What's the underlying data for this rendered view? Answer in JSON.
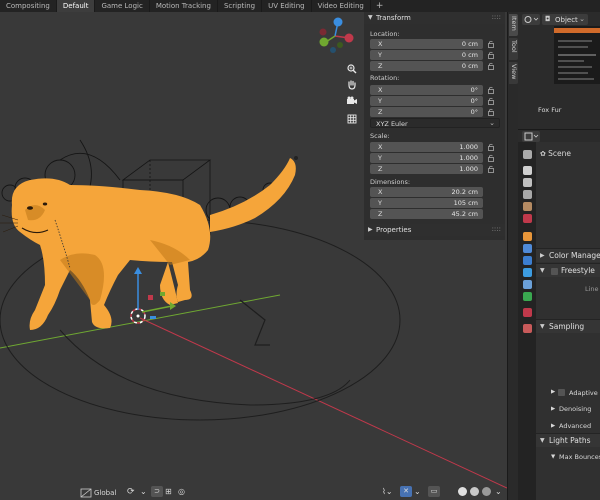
{
  "workspace_tabs": [
    "Compositing",
    "Default",
    "Game Logic",
    "Motion Tracking",
    "Scripting",
    "UV Editing",
    "Video Editing"
  ],
  "active_tab_index": 1,
  "add_tab_label": "+",
  "viewport": {
    "nav_icons": [
      "zoom-icon",
      "hand-pan-icon",
      "camera-icon",
      "grid-icon"
    ],
    "gizmo_axes": [
      "X",
      "Y",
      "Z"
    ],
    "bottom_bar": {
      "orientation_label": "Global",
      "header_right_icons": [
        "overlay-icon",
        "xray-icon",
        "wireframe-shading-icon",
        "solid-shading-icon",
        "material-shading-icon",
        "rendered-shading-icon"
      ]
    }
  },
  "npanel": {
    "transform_title": "Transform",
    "location": {
      "label": "Location:",
      "fields": [
        {
          "axis": "X",
          "value": "0 cm"
        },
        {
          "axis": "Y",
          "value": "0 cm"
        },
        {
          "axis": "Z",
          "value": "0 cm"
        }
      ]
    },
    "rotation": {
      "label": "Rotation:",
      "fields": [
        {
          "axis": "X",
          "value": "0°"
        },
        {
          "axis": "Y",
          "value": "0°"
        },
        {
          "axis": "Z",
          "value": "0°"
        }
      ],
      "mode": "XYZ Euler"
    },
    "scale": {
      "label": "Scale:",
      "fields": [
        {
          "axis": "X",
          "value": "1.000"
        },
        {
          "axis": "Y",
          "value": "1.000"
        },
        {
          "axis": "Z",
          "value": "1.000"
        }
      ]
    },
    "dimensions": {
      "label": "Dimensions:",
      "fields": [
        {
          "axis": "X",
          "value": "20.2 cm"
        },
        {
          "axis": "Y",
          "value": "105 cm"
        },
        {
          "axis": "Z",
          "value": "45.2 cm"
        }
      ]
    },
    "properties_title": "Properties",
    "dots": "::::"
  },
  "sidebar_tabs": [
    "Item",
    "Tool",
    "View"
  ],
  "right_editor": {
    "mode_label": "Object",
    "thumbnail_label": "Fox Fur",
    "properties": {
      "scene_label": "Scene",
      "color_management_label": "Color Managem",
      "freestyle_label": "Freestyle",
      "line_label": "Line",
      "sampling_label": "Sampling",
      "adaptive_label": "Adaptive S",
      "denoising_label": "Denoising",
      "advanced_label": "Advanced",
      "light_paths_label": "Light Paths",
      "max_bounces_label": "Max Bounces"
    },
    "accent_color": "#4772b3",
    "highlight_color": "#d06a2a"
  },
  "colors": {
    "viewport_bg": "#393939",
    "fur": "#f5a53a",
    "x_axis": "#c0394b",
    "y_axis": "#70a830",
    "z_axis": "#3a8ee0",
    "active_tab": "#3d3d3d"
  }
}
